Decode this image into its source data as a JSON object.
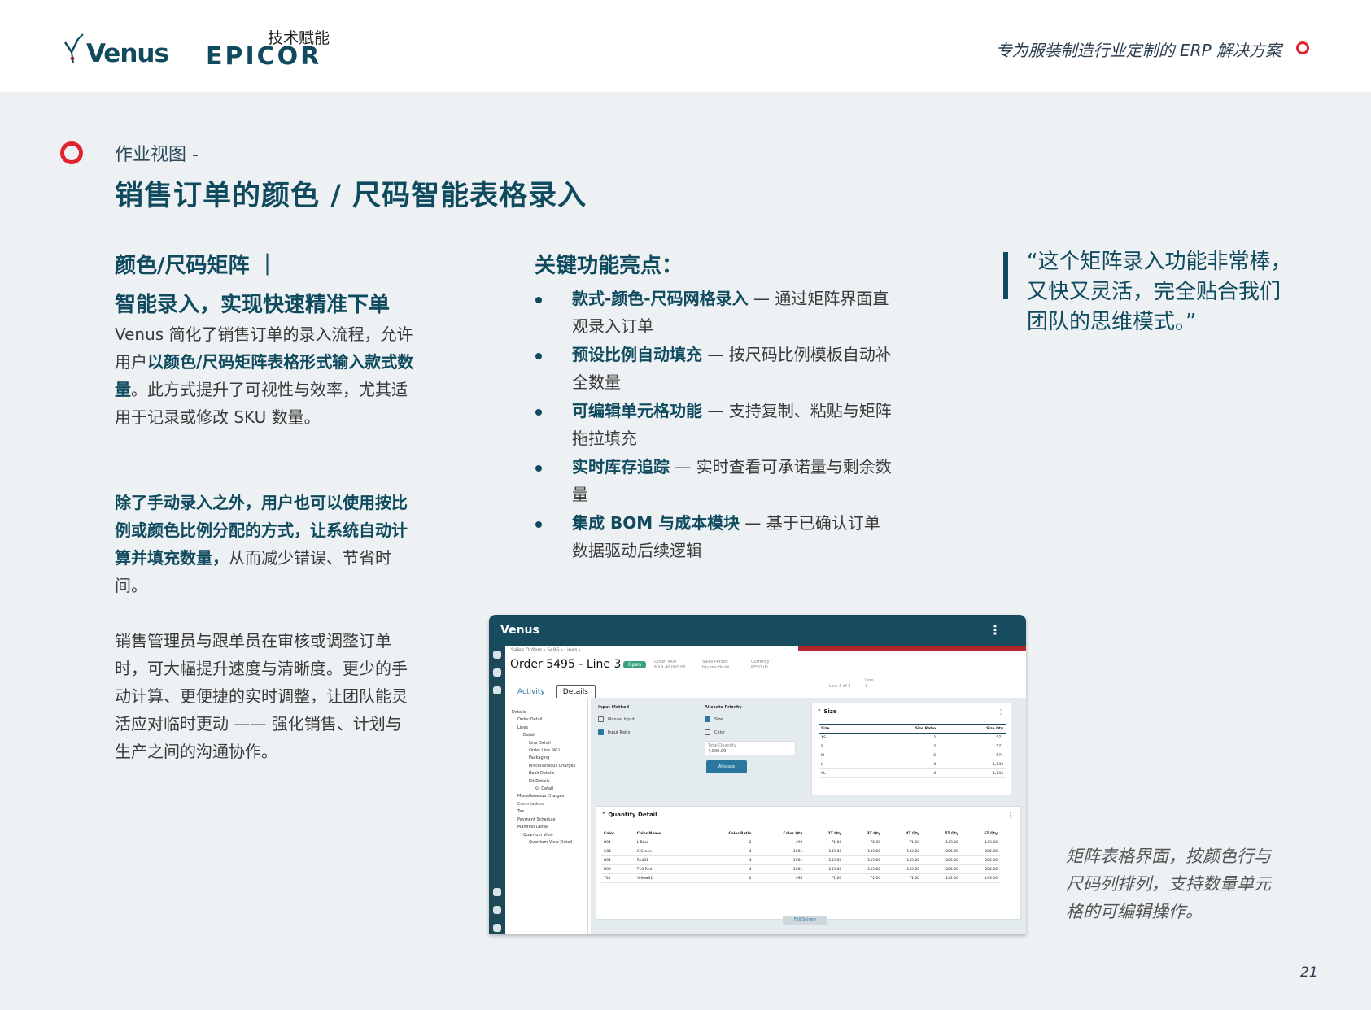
{
  "header": {
    "venus_logo": "Venus",
    "epicor_tag": "技术赋能",
    "epicor_logo": "EPICOR",
    "tagline": "专为服装制造行业定制的 ERP 解决方案"
  },
  "section": {
    "kicker": "作业视图 -",
    "title": "销售订单的颜色 / 尺码智能表格录入"
  },
  "left": {
    "heading1": "颜色/尺码矩阵 ｜",
    "heading2": "智能录入，实现快速精准下单",
    "p1_a": "Venus 简化了销售订单的录入流程，允许用户",
    "p1_b": "以颜色/尺码矩阵表格形式输入款式数量",
    "p1_c": "。此方式提升了可视性与效率，尤其适用于记录或修改 SKU 数量。",
    "p2_a": "除了手动录入之外，用户也可以使用按比例或颜色比例分配的方式，让系统自动计算并填充数量，",
    "p2_b": "从而减少错误、节省时间。",
    "p3": "销售管理员与跟单员在审核或调整订单时，可大幅提升速度与清晰度。更少的手动计算、更便捷的实时调整，让团队能灵活应对临时更动 —— 强化销售、计划与生产之间的沟通协作。"
  },
  "middle": {
    "heading": "关键功能亮点：",
    "bullets": [
      {
        "bold": "款式-颜色-尺码网格录入",
        "text": " — 通过矩阵界面直观录入订单"
      },
      {
        "bold": "预设比例自动填充",
        "text": " — 按尺码比例模板自动补全数量"
      },
      {
        "bold": "可编辑单元格功能",
        "text": " — 支持复制、粘贴与矩阵拖拉填充"
      },
      {
        "bold": "实时库存追踪",
        "text": " — 实时查看可承诺量与剩余数量"
      },
      {
        "bold": "集成 BOM 与成本模块",
        "text": " — 基于已确认订单数据驱动后续逻辑"
      }
    ]
  },
  "quote": "“这个矩阵录入功能非常棒，又快又灵活，完全贴合我们团队的思维模式。”",
  "caption": "矩阵表格界面，按颜色行与尺码列排列，支持数量单元格的可编辑操作。",
  "page_number": "21",
  "screenshot": {
    "brand": "Venus",
    "breadcrumb": "Sales Orders  ›  5495  ›  Lines  ›",
    "order_title": "Order 5495 - Line 3",
    "status": "Open",
    "order_total_label": "Order Total",
    "order_total": "MXN 40,000.00",
    "sales_person_label": "Sales Person",
    "sales_person": "Hyuma Hoshi",
    "currency_label": "Currency",
    "currency": "PESO (D...",
    "tabs": [
      "Activity",
      "Details"
    ],
    "line_nav": "Line 3 of 3",
    "line_label": "Line",
    "line_value": "3",
    "tree": [
      "Details",
      "Order Detail",
      "Lines",
      "Detail",
      "Line Detail",
      "Order Line SKU",
      "Packaging",
      "Miscellaneous Charges",
      "Book Details",
      "Kit Details",
      "Kit Detail",
      "Miscellaneous Charges",
      "Commissions",
      "Tax",
      "Payment Schedule",
      "Manifest Detail",
      "Quantum View",
      "Quantum View Detail"
    ],
    "input_method_label": "Input Method",
    "manual_input": "Manual Input",
    "input_ratio": "Input Ratio",
    "allocate_priority_label": "Allocate Priority",
    "size_opt": "Size",
    "color_opt": "Color",
    "total_qty_label": "Total Quantity",
    "total_qty": "4,000.00",
    "allocate_btn": "Allocate",
    "size_section": "Size",
    "size_headers": [
      "Size",
      "Size Ratio",
      "Size Qty"
    ],
    "size_rows": [
      [
        "XS",
        "2",
        "571"
      ],
      [
        "S",
        "2",
        "571"
      ],
      [
        "M",
        "2",
        "571"
      ],
      [
        "L",
        "4",
        "1,143"
      ],
      [
        "XL",
        "4",
        "1,144"
      ]
    ],
    "qty_section": "Quantity Detail",
    "qty_headers": [
      "Color",
      "Color Name",
      "Color Ratio",
      "Color Qty",
      "2T Qty",
      "3T Qty",
      "4T Qty",
      "5T Qty",
      "6T Qty"
    ],
    "qty_rows": [
      [
        "B01",
        "L Blue",
        "2",
        "499",
        "71.00",
        "71.00",
        "71.00",
        "143.00",
        "143.00"
      ],
      [
        "G01",
        "C Green",
        "4",
        "1001",
        "143.00",
        "143.00",
        "143.00",
        "286.00",
        "286.00"
      ],
      [
        "R01",
        "Red01",
        "4",
        "1001",
        "143.00",
        "143.00",
        "143.00",
        "286.00",
        "286.00"
      ],
      [
        "R02",
        "T10 Red",
        "4",
        "1001",
        "143.00",
        "143.00",
        "143.00",
        "286.00",
        "286.00"
      ],
      [
        "Y01",
        "Yellow01",
        "2",
        "498",
        "71.00",
        "71.00",
        "71.00",
        "142.00",
        "143.00"
      ]
    ],
    "full_screen": "Full Screen"
  },
  "colors": {
    "brand_teal": "#0f4a5e",
    "accent_red": "#e0242d",
    "background": "#edf1f3"
  }
}
